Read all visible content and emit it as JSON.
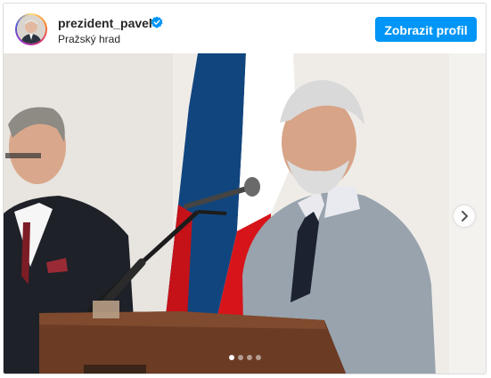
{
  "post": {
    "username": "prezident_pavel",
    "verified": true,
    "location": "Pražský hrad",
    "profile_button_label": "Zobrazit profil",
    "carousel": {
      "slide_count": 4,
      "active_index": 0,
      "next_icon": "chevron-right-icon"
    }
  },
  "colors": {
    "accent": "#0095f6",
    "flag_white": "#ffffff",
    "flag_red": "#d7141a",
    "flag_blue": "#11457e"
  }
}
